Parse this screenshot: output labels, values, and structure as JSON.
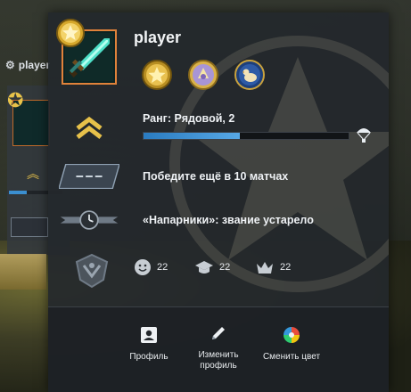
{
  "background": {
    "player_label": "player"
  },
  "profile": {
    "name": "player",
    "medals": [
      "gold-star-medal",
      "pin-medal",
      "duck-medal"
    ]
  },
  "rank": {
    "label": "Ранг: Рядовой, 2",
    "progress_percent": 47
  },
  "matches": {
    "label": "Победите ещё в 10 матчах"
  },
  "wingman": {
    "label": "«Напарники»: звание устарело"
  },
  "stats": {
    "friendly": "22",
    "teacher": "22",
    "leader": "22"
  },
  "actions": {
    "profile": "Профиль",
    "edit_profile": "Изменить профиль",
    "change_color": "Сменить цвет"
  },
  "colors": {
    "accent_blue": "#3b8fd0",
    "avatar_border": "#e0823a",
    "rank_gold": "#e7c14a"
  }
}
